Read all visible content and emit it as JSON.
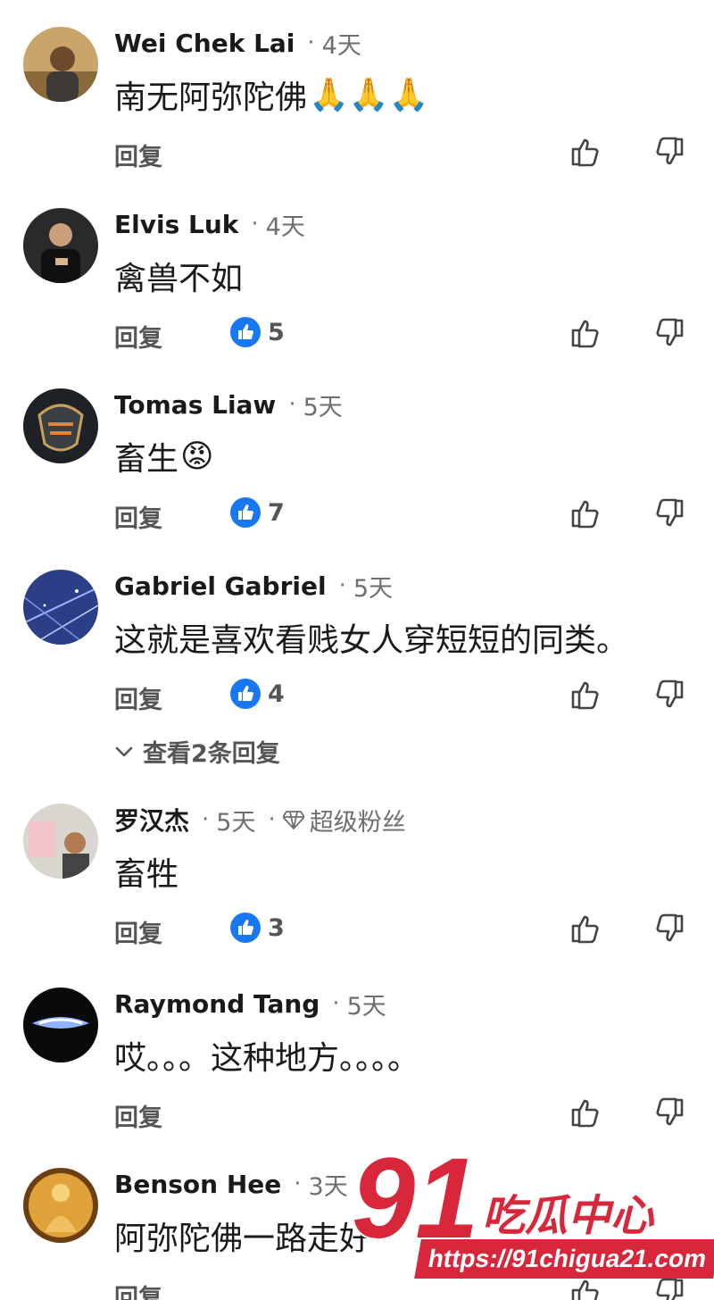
{
  "comments": [
    {
      "name": "Wei Chek Lai",
      "sep": "·",
      "time": "4天",
      "text": "南无阿弥陀佛",
      "emoji": "🙏🙏🙏",
      "reply_label": "回复",
      "likes": "",
      "avatar": "avatar-landscape"
    },
    {
      "name": "Elvis Luk",
      "sep": "·",
      "time": "4天",
      "text": "禽兽不如",
      "emoji": "",
      "reply_label": "回复",
      "likes": "5",
      "avatar": "avatar-person-dark"
    },
    {
      "name": "Tomas Liaw",
      "sep": "·",
      "time": "5天",
      "text": "畜生",
      "emoji": "😡",
      "reply_label": "回复",
      "likes": "7",
      "avatar": "avatar-logo"
    },
    {
      "name": "Gabriel Gabriel",
      "sep": "·",
      "time": "5天",
      "text": "这就是喜欢看贱女人穿短短的同类。",
      "emoji": "",
      "reply_label": "回复",
      "likes": "4",
      "avatar": "avatar-galaxy"
    },
    {
      "name": "罗汉杰",
      "sep": "·",
      "time": "5天",
      "badge_sep": "·",
      "badge": "超级粉丝",
      "text": "畜牲",
      "emoji": "",
      "reply_label": "回复",
      "likes": "3",
      "avatar": "avatar-selfie"
    },
    {
      "name": "Raymond Tang",
      "sep": "·",
      "time": "5天",
      "text": "哎。。。这种地方。。。。",
      "emoji": "",
      "reply_label": "回复",
      "likes": "",
      "avatar": "avatar-car-light"
    },
    {
      "name": "Benson Hee",
      "sep": "·",
      "time": "3天",
      "text": "阿弥陀佛一路走好",
      "emoji": "",
      "reply_label": "回复",
      "likes": "",
      "avatar": "avatar-buddha"
    }
  ],
  "view_replies": "查看2条回复",
  "watermark": {
    "number": "91",
    "brand": "吃瓜中心",
    "url": "https://91chigua21.com"
  },
  "colors": {
    "like_blue": "#1877f2",
    "watermark_red": "#d8263b"
  }
}
